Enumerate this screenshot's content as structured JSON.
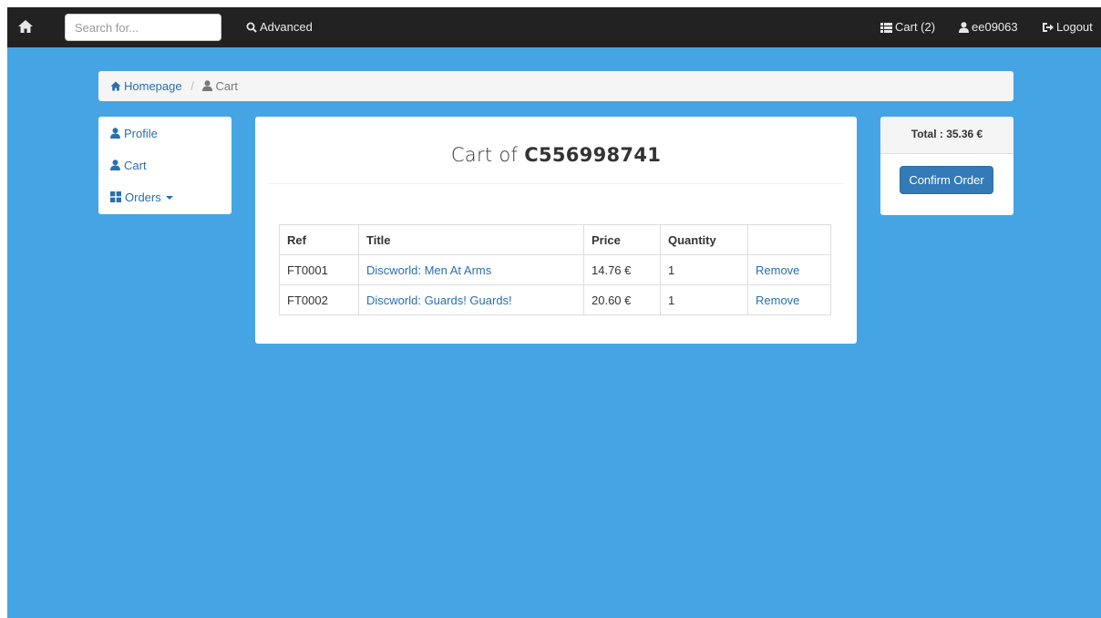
{
  "navbar": {
    "home_icon": "home-icon",
    "search_placeholder": "Search for...",
    "advanced_label": "Advanced",
    "cart_label": "Cart (2)",
    "user_label": "ee09063",
    "logout_label": "Logout"
  },
  "breadcrumb": {
    "home_label": "Homepage",
    "current_label": "Cart"
  },
  "sidemenu": {
    "items": [
      {
        "label": "Profile",
        "icon": "user-icon"
      },
      {
        "label": "Cart",
        "icon": "user-icon"
      },
      {
        "label": "Orders",
        "icon": "grid-icon"
      }
    ]
  },
  "cart": {
    "title_prefix": "Cart of",
    "cart_id": "C556998741",
    "columns": [
      "Ref",
      "Title",
      "Price",
      "Quantity",
      ""
    ],
    "rows": [
      {
        "ref": "FT0001",
        "title": "Discworld: Men At Arms",
        "price": "14.76 €",
        "quantity": "1",
        "action": "Remove"
      },
      {
        "ref": "FT0002",
        "title": "Discworld: Guards! Guards!",
        "price": "20.60 €",
        "quantity": "1",
        "action": "Remove"
      }
    ]
  },
  "summary": {
    "total_label": "Total : 35.36 €",
    "confirm_label": "Confirm Order"
  },
  "colors": {
    "background": "#45a5e4",
    "navbar": "#222222",
    "link": "#2a6fb0",
    "primary_button": "#337ab7"
  }
}
